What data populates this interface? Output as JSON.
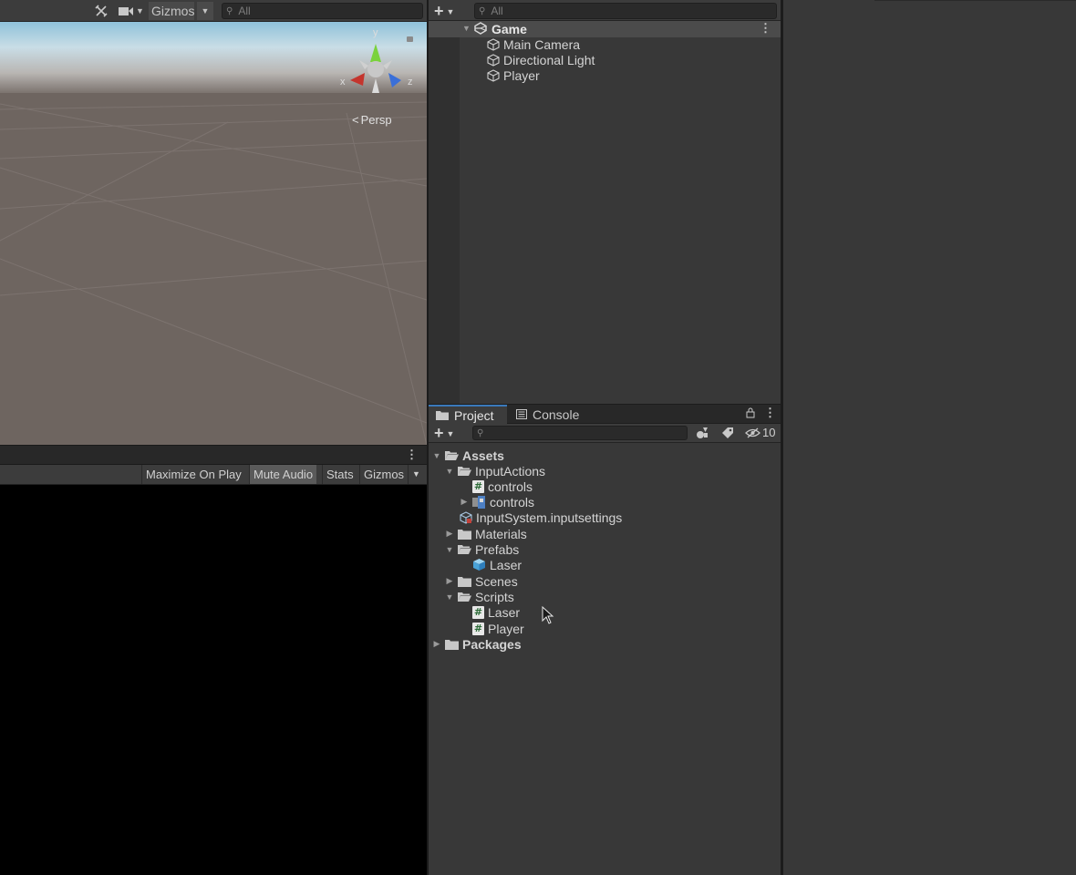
{
  "scene": {
    "toolbar": {
      "gizmos_label": "Gizmos",
      "search_placeholder": "All"
    },
    "persp_label": "Persp",
    "axis_labels": {
      "x": "x",
      "y": "y",
      "z": "z"
    }
  },
  "game": {
    "toolbar": {
      "maximize_on_play": "Maximize On Play",
      "mute_audio": "Mute Audio",
      "stats": "Stats",
      "gizmos": "Gizmos"
    }
  },
  "hierarchy": {
    "search_placeholder": "All",
    "scene_name": "Game",
    "objects": [
      "Main Camera",
      "Directional Light",
      "Player"
    ]
  },
  "project": {
    "tabs": [
      {
        "label": "Project",
        "icon": "folder-icon",
        "active": true
      },
      {
        "label": "Console",
        "icon": "console-icon",
        "active": false
      }
    ],
    "hidden_count": "10",
    "tree": {
      "assets": "Assets",
      "input_actions": "InputActions",
      "controls_script": "controls",
      "controls_asset": "controls",
      "input_settings": "InputSystem.inputsettings",
      "materials": "Materials",
      "prefabs": "Prefabs",
      "laser_prefab": "Laser",
      "scenes": "Scenes",
      "scripts": "Scripts",
      "laser_script": "Laser",
      "player_script": "Player",
      "packages": "Packages"
    }
  },
  "colors": {
    "panel": "#383838",
    "toolbar": "#3c3c3c",
    "selection": "#4b4b4b",
    "scene_ground": "#6e6560",
    "sky": "#a9cfe2",
    "accent": "#3a79bb"
  }
}
